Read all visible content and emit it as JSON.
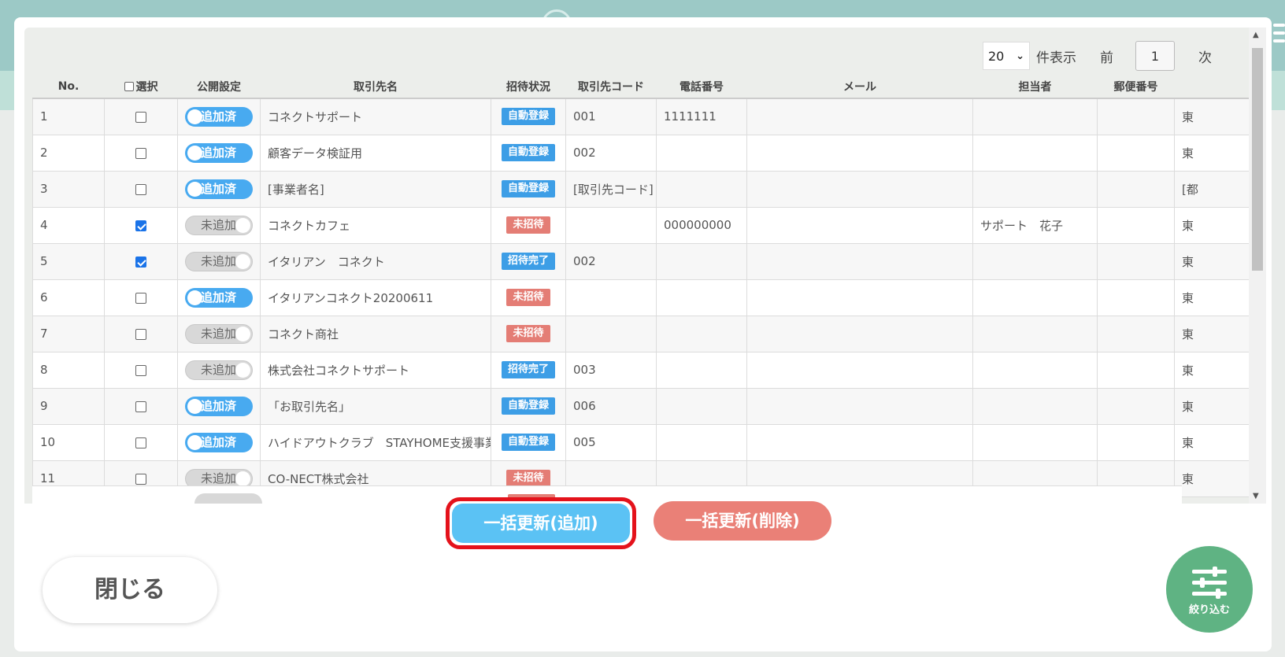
{
  "pager": {
    "per_page": "20",
    "per_page_label": "件表示",
    "prev": "前",
    "page": "1",
    "next": "次"
  },
  "columns": {
    "no": "No.",
    "select": "選択",
    "publish": "公開設定",
    "name": "取引先名",
    "invite": "招待状況",
    "code": "取引先コード",
    "phone": "電話番号",
    "mail": "メール",
    "person": "担当者",
    "zip": "郵便番号"
  },
  "rows": [
    {
      "no": "1",
      "checked": false,
      "publish": "追加済",
      "publish_on": true,
      "name": "コネクトサポート",
      "invite": "自動登録",
      "invite_color": "blue",
      "code": "001",
      "phone": "1111111",
      "mail": "",
      "person": "",
      "zip": "",
      "extra": "東"
    },
    {
      "no": "2",
      "checked": false,
      "publish": "追加済",
      "publish_on": true,
      "name": "顧客データ検証用",
      "invite": "自動登録",
      "invite_color": "blue",
      "code": "002",
      "phone": "",
      "mail": "",
      "person": "",
      "zip": "",
      "extra": "東"
    },
    {
      "no": "3",
      "checked": false,
      "publish": "追加済",
      "publish_on": true,
      "name": "[事業者名]",
      "invite": "自動登録",
      "invite_color": "blue",
      "code": "[取引先コード]",
      "phone": "",
      "mail": "",
      "person": "",
      "zip": "",
      "extra": "[都"
    },
    {
      "no": "4",
      "checked": true,
      "publish": "未追加",
      "publish_on": false,
      "name": "コネクトカフェ",
      "invite": "未招待",
      "invite_color": "red",
      "code": "",
      "phone": "000000000",
      "mail": "",
      "person": "サポート　花子",
      "zip": "",
      "extra": "東"
    },
    {
      "no": "5",
      "checked": true,
      "publish": "未追加",
      "publish_on": false,
      "name": "イタリアン　コネクト",
      "invite": "招待完了",
      "invite_color": "blue",
      "code": "002",
      "phone": "",
      "mail": "",
      "person": "",
      "zip": "",
      "extra": "東"
    },
    {
      "no": "6",
      "checked": false,
      "publish": "追加済",
      "publish_on": true,
      "name": "イタリアンコネクト20200611",
      "invite": "未招待",
      "invite_color": "red",
      "code": "",
      "phone": "",
      "mail": "",
      "person": "",
      "zip": "",
      "extra": "東"
    },
    {
      "no": "7",
      "checked": false,
      "publish": "未追加",
      "publish_on": false,
      "name": "コネクト商社",
      "invite": "未招待",
      "invite_color": "red",
      "code": "",
      "phone": "",
      "mail": "",
      "person": "",
      "zip": "",
      "extra": "東"
    },
    {
      "no": "8",
      "checked": false,
      "publish": "未追加",
      "publish_on": false,
      "name": "株式会社コネクトサポート",
      "invite": "招待完了",
      "invite_color": "blue",
      "code": "003",
      "phone": "",
      "mail": "",
      "person": "",
      "zip": "",
      "extra": "東"
    },
    {
      "no": "9",
      "checked": false,
      "publish": "追加済",
      "publish_on": true,
      "name": "「お取引先名」",
      "invite": "自動登録",
      "invite_color": "blue",
      "code": "006",
      "phone": "",
      "mail": "",
      "person": "",
      "zip": "",
      "extra": "東"
    },
    {
      "no": "10",
      "checked": false,
      "publish": "追加済",
      "publish_on": true,
      "name": "ハイドアウトクラブ　STAYHOME支援事業",
      "invite": "自動登録",
      "invite_color": "blue",
      "code": "005",
      "phone": "",
      "mail": "",
      "person": "",
      "zip": "",
      "extra": "東"
    },
    {
      "no": "11",
      "checked": false,
      "publish": "未追加",
      "publish_on": false,
      "name": "CO-NECT株式会社",
      "invite": "未招待",
      "invite_color": "red",
      "code": "",
      "phone": "",
      "mail": "",
      "person": "",
      "zip": "",
      "extra": "東"
    }
  ],
  "actions": {
    "bulk_add": "一括更新(追加)",
    "bulk_delete": "一括更新(削除)",
    "close": "閉じる",
    "filter": "絞り込む"
  },
  "colors": {
    "publish_on": "#48aaf0",
    "badge_blue": "#3d9ee6",
    "badge_red": "#e47d75",
    "add_button": "#5bc2f4",
    "delete_button": "#ea8077",
    "highlight": "#e4121b",
    "filter_button": "#5fb383"
  }
}
